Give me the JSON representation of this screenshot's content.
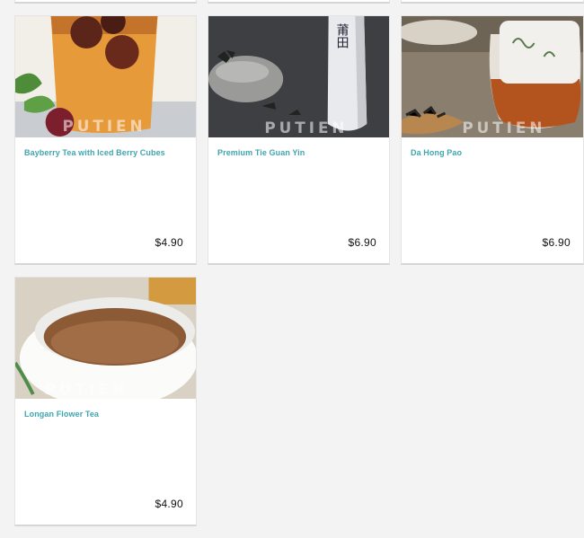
{
  "products": [
    {
      "name": "Bayberry Tea with Iced Berry Cubes",
      "price": "$4.90",
      "watermark": "PUTIEN"
    },
    {
      "name": "Premium Tie Guan Yin",
      "price": "$6.90",
      "watermark": "PUTIEN",
      "bottle_text": "莆田"
    },
    {
      "name": "Da Hong Pao",
      "price": "$6.90",
      "watermark": "PUTIEN"
    },
    {
      "name": "Longan Flower Tea",
      "price": "$4.90",
      "watermark": "PUTIEN"
    }
  ],
  "colors": {
    "accent": "#3fa6b0",
    "background": "#f4f3f3",
    "card": "#ffffff"
  }
}
